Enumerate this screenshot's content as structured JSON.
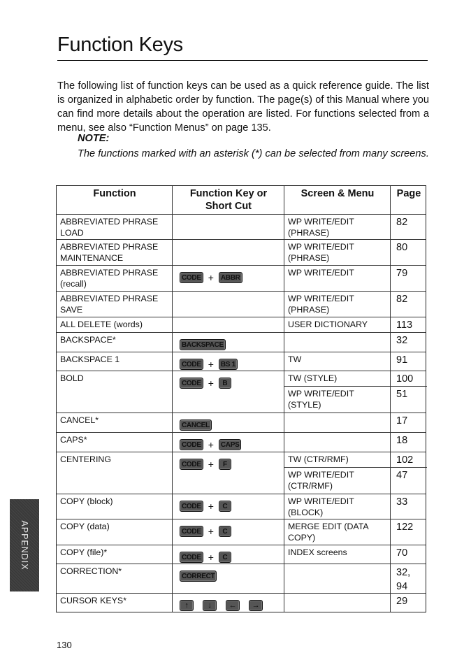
{
  "page": {
    "title": "Function Keys",
    "intro": "The following list of function keys can be used as a quick reference guide. The list is organized in alphabetic order by function. The page(s) of this Manual where you can find more details about the operation are listed. For functions selected from a menu, see also “Function Menus” on page 135.",
    "note_label": "NOTE:",
    "note_text": "The functions marked with an asterisk (*) can be selected from many screens.",
    "side_tab": "APPENDIX",
    "page_number": "130"
  },
  "table": {
    "headers": [
      "Function",
      "Function Key or Short Cut",
      "Screen & Menu",
      "Page"
    ],
    "rows": [
      {
        "function": "ABBREVIATED PHRASE LOAD",
        "keys": [],
        "entries": [
          {
            "screen": "WP WRITE/EDIT (PHRASE)",
            "page": "82"
          }
        ]
      },
      {
        "function": "ABBREVIATED PHRASE MAINTENANCE",
        "keys": [],
        "entries": [
          {
            "screen": "WP WRITE/EDIT (PHRASE)",
            "page": "80"
          }
        ]
      },
      {
        "function": "ABBREVIATED PHRASE (recall)",
        "keys": [
          "CODE",
          "+",
          "ABBR"
        ],
        "entries": [
          {
            "screen": "WP WRITE/EDIT",
            "page": "79"
          }
        ]
      },
      {
        "function": "ABBREVIATED PHRASE SAVE",
        "keys": [],
        "entries": [
          {
            "screen": "WP WRITE/EDIT (PHRASE)",
            "page": "82"
          }
        ]
      },
      {
        "function": "ALL DELETE (words)",
        "keys": [],
        "entries": [
          {
            "screen": "USER DICTIONARY",
            "page": "113"
          }
        ]
      },
      {
        "function": "BACKSPACE*",
        "keys": [
          "BACKSPACE"
        ],
        "entries": [
          {
            "screen": "",
            "page": "32"
          }
        ]
      },
      {
        "function": "BACKSPACE 1",
        "keys": [
          "CODE",
          "+",
          "BS 1"
        ],
        "entries": [
          {
            "screen": "TW",
            "page": "91"
          }
        ]
      },
      {
        "function": "BOLD",
        "keys": [
          "CODE",
          "+",
          "B"
        ],
        "entries": [
          {
            "screen": "TW (STYLE)",
            "page": "100"
          },
          {
            "screen": "WP WRITE/EDIT (STYLE)",
            "page": "51"
          }
        ]
      },
      {
        "function": "CANCEL*",
        "keys": [
          "CANCEL"
        ],
        "entries": [
          {
            "screen": "",
            "page": "17"
          }
        ]
      },
      {
        "function": "CAPS*",
        "keys": [
          "CODE",
          "+",
          "CAPS"
        ],
        "entries": [
          {
            "screen": "",
            "page": "18"
          }
        ]
      },
      {
        "function": "CENTERING",
        "keys": [
          "CODE",
          "+",
          "F"
        ],
        "entries": [
          {
            "screen": "TW (CTR/RMF)",
            "page": "102"
          },
          {
            "screen": "WP WRITE/EDIT (CTR/RMF)",
            "page": "47"
          }
        ]
      },
      {
        "function": "COPY (block)",
        "keys": [
          "CODE",
          "+",
          "C"
        ],
        "entries": [
          {
            "screen": "WP WRITE/EDIT (BLOCK)",
            "page": "33"
          }
        ]
      },
      {
        "function": "COPY (data)",
        "keys": [
          "CODE",
          "+",
          "C"
        ],
        "entries": [
          {
            "screen": "MERGE EDIT (DATA COPY)",
            "page": "122"
          }
        ]
      },
      {
        "function": "COPY (file)*",
        "keys": [
          "CODE",
          "+",
          "C"
        ],
        "entries": [
          {
            "screen": "INDEX screens",
            "page": "70"
          }
        ]
      },
      {
        "function": "CORRECTION*",
        "keys": [
          "CORRECT"
        ],
        "entries": [
          {
            "screen": "",
            "page": "32, 94"
          }
        ]
      },
      {
        "function": "CURSOR KEYS*",
        "keys": [
          "↑",
          "↓",
          "←",
          "→"
        ],
        "entries": [
          {
            "screen": "",
            "page": "29"
          }
        ]
      }
    ]
  }
}
